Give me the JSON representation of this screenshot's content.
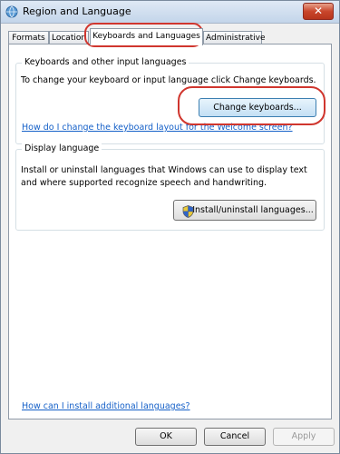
{
  "window": {
    "title": "Region and Language",
    "close_label": "✕"
  },
  "tabs": [
    {
      "label": "Formats"
    },
    {
      "label": "Location"
    },
    {
      "label": "Keyboards and Languages"
    },
    {
      "label": "Administrative"
    }
  ],
  "keyboards": {
    "group_title": "Keyboards and other input languages",
    "description": "To change your keyboard or input language click Change keyboards.",
    "change_button": "Change keyboards...",
    "help_link": "How do I change the keyboard layout for the Welcome screen?"
  },
  "display_language": {
    "group_title": "Display language",
    "description": "Install or uninstall languages that Windows can use to display text and where supported recognize speech and handwriting.",
    "install_button": "Install/uninstall languages..."
  },
  "bottom_link": "How can I install additional languages?",
  "footer": {
    "ok": "OK",
    "cancel": "Cancel",
    "apply": "Apply"
  },
  "colors": {
    "annotation": "#d0362e",
    "link": "#1560c8"
  }
}
